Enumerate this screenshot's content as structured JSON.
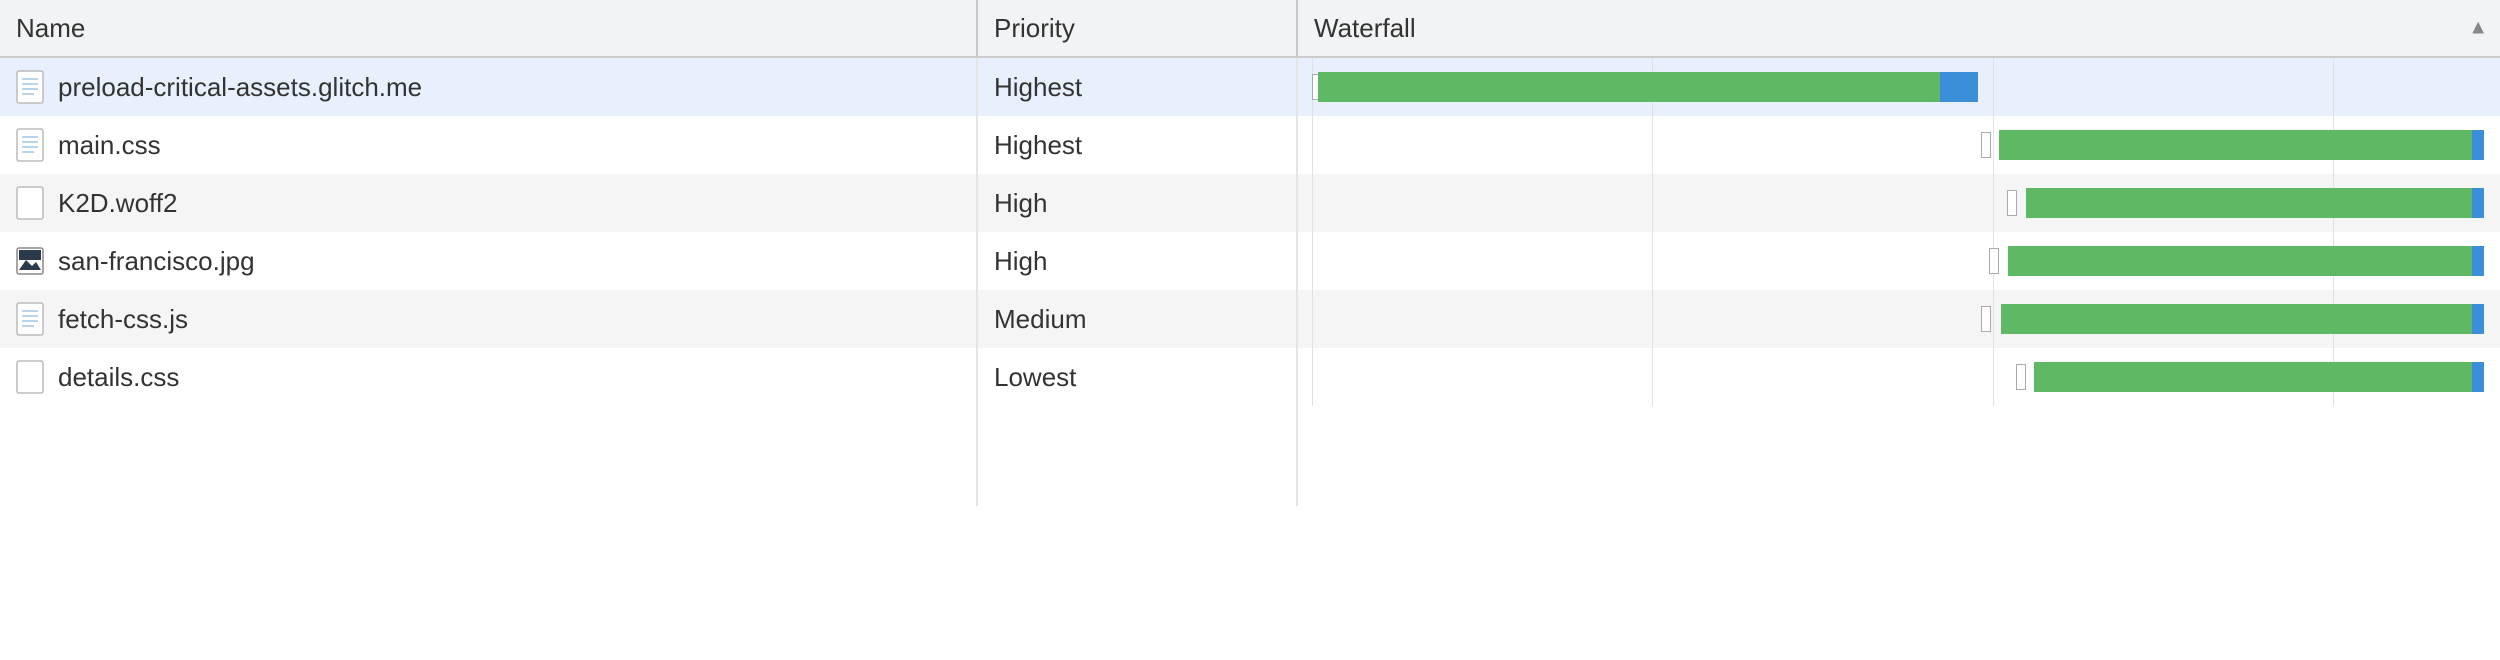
{
  "headers": {
    "name": "Name",
    "priority": "Priority",
    "waterfall": "Waterfall"
  },
  "sort_column": "waterfall",
  "sort_direction": "asc",
  "sort_glyph": "▲",
  "waterfall_gridlines_pct": [
    0,
    29,
    58,
    87
  ],
  "rows": [
    {
      "name": "preload-critical-assets.glitch.me",
      "priority": "Highest",
      "icon": "document",
      "selected": true,
      "waterfall": {
        "tick_left_pct": 0.0,
        "start_pct": 0.5,
        "green_pct": 53.0,
        "blue_pct": 3.2
      }
    },
    {
      "name": "main.css",
      "priority": "Highest",
      "icon": "document",
      "selected": false,
      "waterfall": {
        "tick_left_pct": 57.0,
        "start_pct": 58.5,
        "green_pct": 40.3,
        "blue_pct": 1.0
      }
    },
    {
      "name": "K2D.woff2",
      "priority": "High",
      "icon": "file",
      "selected": false,
      "waterfall": {
        "tick_left_pct": 59.2,
        "start_pct": 60.8,
        "green_pct": 38.0,
        "blue_pct": 1.0
      }
    },
    {
      "name": "san-francisco.jpg",
      "priority": "High",
      "icon": "image",
      "selected": false,
      "waterfall": {
        "tick_left_pct": 57.7,
        "start_pct": 59.3,
        "green_pct": 39.5,
        "blue_pct": 1.0
      }
    },
    {
      "name": "fetch-css.js",
      "priority": "Medium",
      "icon": "document",
      "selected": false,
      "waterfall": {
        "tick_left_pct": 57.0,
        "start_pct": 58.7,
        "green_pct": 40.1,
        "blue_pct": 1.0
      }
    },
    {
      "name": "details.css",
      "priority": "Lowest",
      "icon": "file",
      "selected": false,
      "waterfall": {
        "tick_left_pct": 60.0,
        "start_pct": 61.5,
        "green_pct": 37.3,
        "blue_pct": 1.0
      }
    }
  ]
}
